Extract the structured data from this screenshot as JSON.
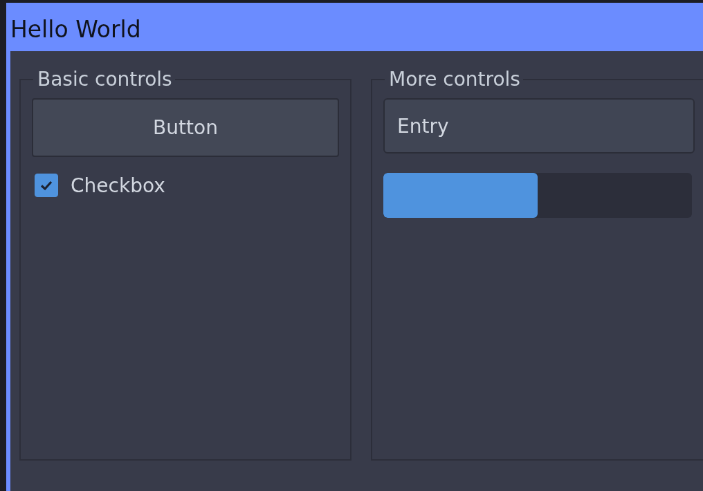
{
  "window": {
    "title": "Hello World"
  },
  "basic_controls": {
    "title": "Basic controls",
    "button": "Button",
    "checkbox": {
      "label": "Checkbox",
      "checked": true
    }
  },
  "more_controls": {
    "title": "More controls",
    "entry": {
      "value": "Entry"
    },
    "progress": {
      "level": 0.5
    }
  }
}
